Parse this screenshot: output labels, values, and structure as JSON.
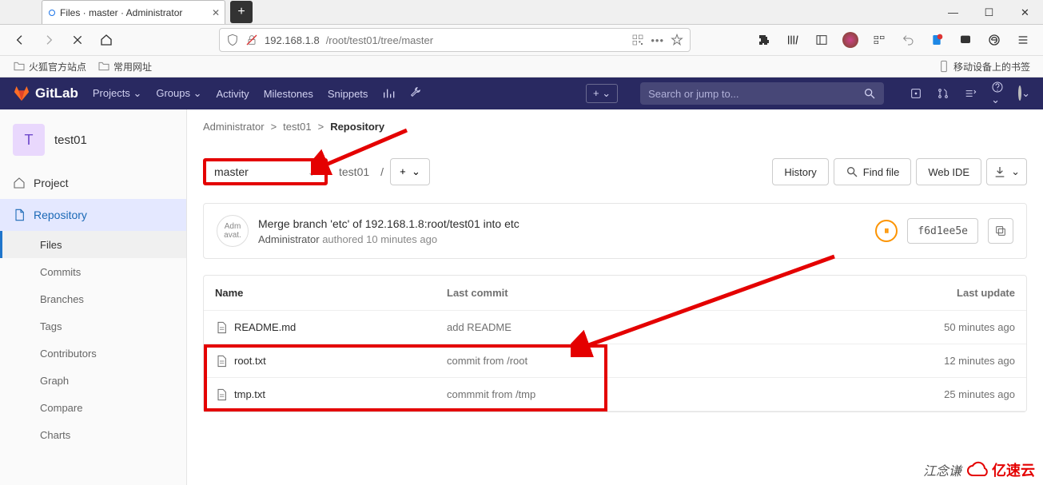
{
  "browser": {
    "tab_title": "Files · master · Administrator",
    "newtab": "+",
    "win": {
      "min": "—",
      "max": "☐",
      "close": "✕"
    },
    "url_host": "192.168.1.8",
    "url_path": "/root/test01/tree/master",
    "bookmarks": {
      "b1": "火狐官方站点",
      "b2": "常用网址",
      "mobile": "移动设备上的书签"
    }
  },
  "nav": {
    "brand": "GitLab",
    "projects": "Projects",
    "groups": "Groups",
    "activity": "Activity",
    "milestones": "Milestones",
    "snippets": "Snippets",
    "search_placeholder": "Search or jump to...",
    "plus": "+"
  },
  "sidebar": {
    "project_initial": "T",
    "project_name": "test01",
    "project": "Project",
    "repository": "Repository",
    "sub": [
      "Files",
      "Commits",
      "Branches",
      "Tags",
      "Contributors",
      "Graph",
      "Compare",
      "Charts"
    ]
  },
  "breadcrumb": {
    "a": "Administrator",
    "b": "test01",
    "c": "Repository",
    "sep": ">"
  },
  "branchrow": {
    "branch": "master",
    "root": "test01",
    "slash": "/",
    "history": "History",
    "findfile": "Find file",
    "webide": "Web IDE"
  },
  "commit": {
    "avatar_text": "Adm avat.",
    "title": "Merge branch 'etc' of 192.168.1.8:root/test01 into etc",
    "author": "Administrator",
    "verb": "authored",
    "time": "10 minutes ago",
    "sha": "f6d1ee5e",
    "pipe": "⏸"
  },
  "table": {
    "h_name": "Name",
    "h_commit": "Last commit",
    "h_update": "Last update",
    "files": [
      {
        "name": "README.md",
        "commit": "add README",
        "update": "50 minutes ago"
      },
      {
        "name": "root.txt",
        "commit": "commit from /root",
        "update": "12 minutes ago"
      },
      {
        "name": "tmp.txt",
        "commit": "commmit from /tmp",
        "update": "25 minutes ago"
      }
    ]
  },
  "watermark": {
    "author": "江念谦",
    "brand": "亿速云"
  }
}
